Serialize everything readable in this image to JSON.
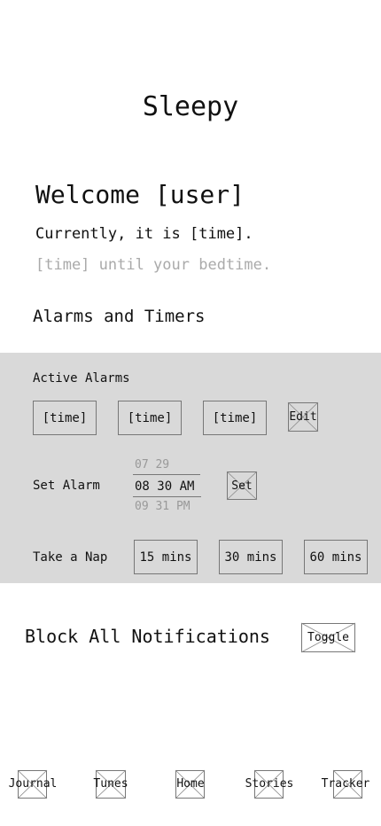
{
  "app": {
    "title": "Sleepy"
  },
  "welcome": {
    "greeting": "Welcome [user]",
    "current_time": "Currently, it is [time].",
    "bedtime_hint": "[time] until your bedtime."
  },
  "alarms_section": {
    "title": "Alarms and Timers",
    "active_alarms": {
      "label": "Active Alarms",
      "alarms": [
        "[time]",
        "[time]",
        "[time]"
      ],
      "edit_label": "Edit"
    },
    "set_alarm": {
      "label": "Set Alarm",
      "picker_above": "07 29",
      "picker_selected": "08 30 AM",
      "picker_below": "09 31 PM",
      "set_label": "Set"
    },
    "nap": {
      "label": "Take a Nap",
      "options": [
        "15 mins",
        "30 mins",
        "60 mins"
      ]
    }
  },
  "notifications": {
    "label": "Block All Notifications",
    "toggle_label": "Toggle"
  },
  "bottom_nav": {
    "items": [
      "Journal",
      "Tunes",
      "Home",
      "Stories",
      "Tracker"
    ]
  },
  "colors": {
    "panel_bg": "#d9d9d9",
    "muted_text": "#aaaaaa",
    "border": "#777777"
  }
}
